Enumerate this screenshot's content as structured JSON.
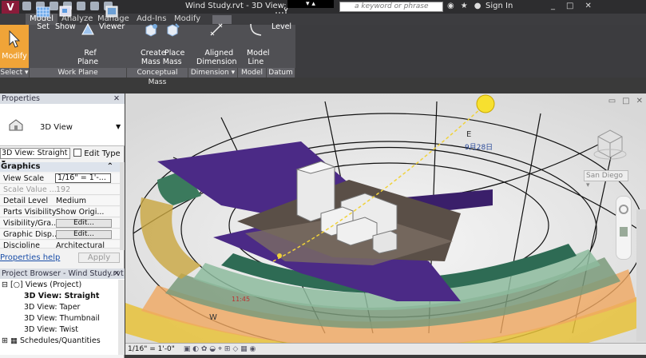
{
  "titlebar": {
    "document_title": "Wind Study.rvt - 3D View: Stra",
    "search_placeholder": "a keyword or phrase",
    "sign_in": "Sign In",
    "black_overlay": "▾ ▴"
  },
  "tabs": [
    "Model",
    "Analyze",
    "Manage",
    "Add-Ins",
    "Modify"
  ],
  "active_tab": "Model",
  "ribbon": {
    "modify": "Modify",
    "buttons": [
      {
        "label": "Set",
        "icon": "grid-icon"
      },
      {
        "label": "Show",
        "icon": "show-icon"
      },
      {
        "label": "Ref\nPlane",
        "icon": "ref-plane-icon"
      },
      {
        "label": "Viewer",
        "icon": "viewer-icon"
      },
      {
        "label": "Create\nMass",
        "icon": "create-mass-icon"
      },
      {
        "label": "Place\nMass",
        "icon": "place-mass-icon"
      },
      {
        "label": "Aligned\nDimension",
        "icon": "aligned-dimension-icon"
      },
      {
        "label": "Model\nLine",
        "icon": "model-line-icon"
      },
      {
        "label": "Level",
        "icon": "level-icon"
      }
    ],
    "panels": [
      "Select",
      "Work Plane",
      "Conceptual Mass",
      "Dimension",
      "Model",
      "Datum"
    ]
  },
  "properties": {
    "header": "Properties",
    "type_name": "3D View",
    "view_filter": "3D View: Straight",
    "edit_type": "Edit Type",
    "section": "Graphics",
    "rows": [
      {
        "key": "View Scale",
        "value": "1/16\" = 1'-..."
      },
      {
        "key": "Scale Value ...",
        "value": "192"
      },
      {
        "key": "Detail Level",
        "value": "Medium"
      },
      {
        "key": "Parts Visibility",
        "value": "Show Origi..."
      },
      {
        "key": "Visibility/Gra...",
        "value": "Edit..."
      },
      {
        "key": "Graphic Disp...",
        "value": "Edit..."
      },
      {
        "key": "Discipline",
        "value": "Architectural"
      }
    ],
    "help_link": "Properties help",
    "apply": "Apply"
  },
  "project_browser": {
    "header": "Project Browser - Wind Study.rvt",
    "root": "Views (Project)",
    "items": [
      "3D View: Straight",
      "3D View: Taper",
      "3D View: Thumbnail",
      "3D View: Twist"
    ],
    "schedules": "Schedules/Quantities"
  },
  "viewport": {
    "sun_date": "9月28日",
    "compass_east": "E",
    "compass_west": "W",
    "viewcube_label": "San Diego",
    "time_label": "11:45"
  },
  "statusbar": {
    "scale": "1/16\" = 1'-0\""
  },
  "colors": {
    "accent": "#f0a438",
    "ribbon": "#505054",
    "titlebar": "#2d2d2f",
    "purple": "#4b2a86"
  }
}
